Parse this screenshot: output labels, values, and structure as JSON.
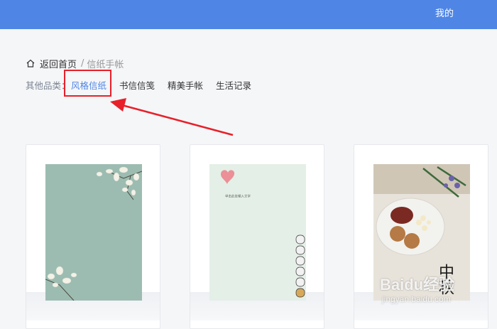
{
  "header": {
    "user_link": "我的"
  },
  "breadcrumb": {
    "home": "返回首页",
    "separator": "/",
    "current": "信纸手帐"
  },
  "categories": {
    "label": "其他品类：",
    "items": [
      {
        "label": "风格信纸",
        "active": true
      },
      {
        "label": "书信信笺",
        "active": false
      },
      {
        "label": "精美手帐",
        "active": false
      },
      {
        "label": "生活记录",
        "active": false
      }
    ]
  },
  "cards": [
    {
      "theme": "magnolia-green"
    },
    {
      "theme": "heart-cats",
      "note_text": "单击此处输入文字"
    },
    {
      "theme": "mid-autumn",
      "calligraphy": "中秋"
    }
  ],
  "watermark": {
    "logo": "Baidu经验",
    "url": "jingyan.baidu.com"
  },
  "colors": {
    "header": "#4f86e6",
    "accent": "#4f86e6",
    "highlight": "#e8202a"
  }
}
